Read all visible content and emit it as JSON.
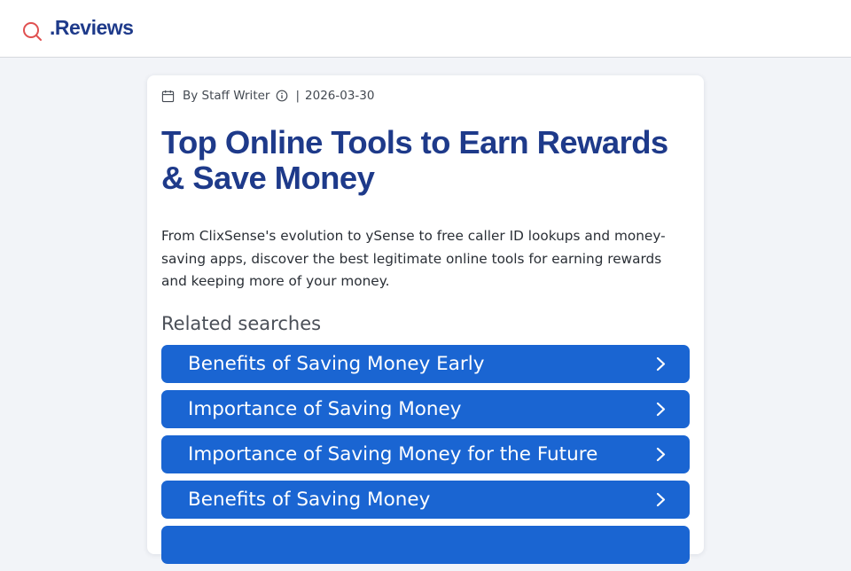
{
  "header": {
    "logo_text": ".Reviews",
    "logo_icon": "search-icon",
    "accent_color": "#e05050",
    "brand_color": "#1e3a8a"
  },
  "article": {
    "author": "By Staff Writer",
    "separator": "|",
    "date": "2026-03-30",
    "title": "Top Online Tools to Earn Rewards & Save Money",
    "description": "From ClixSense's evolution to ySense to free caller ID lookups and money-saving apps, discover the best legitimate online tools for earning rewards and keeping more of your money."
  },
  "related": {
    "heading": "Related searches",
    "button_color": "#1a65d2",
    "items": [
      {
        "label": "Benefits of Saving Money Early"
      },
      {
        "label": "Importance of Saving Money"
      },
      {
        "label": "Importance of Saving Money for the Future"
      },
      {
        "label": "Benefits of Saving Money"
      },
      {
        "label": ""
      }
    ]
  }
}
